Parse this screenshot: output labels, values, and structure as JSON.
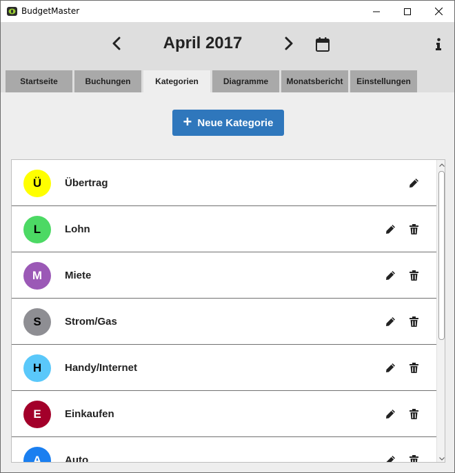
{
  "window": {
    "title": "BudgetMaster",
    "icon": "budgetmaster-logo-icon"
  },
  "header": {
    "month": "April 2017",
    "prev_icon": "chevron-left-icon",
    "next_icon": "chevron-right-icon",
    "calendar_icon": "calendar-icon",
    "info_icon": "info-icon"
  },
  "tabs": [
    {
      "label": "Startseite",
      "active": false
    },
    {
      "label": "Buchungen",
      "active": false
    },
    {
      "label": "Kategorien",
      "active": true
    },
    {
      "label": "Diagramme",
      "active": false
    },
    {
      "label": "Monatsbericht",
      "active": false
    },
    {
      "label": "Einstellungen",
      "active": false
    }
  ],
  "actions": {
    "new_category_label": "Neue Kategorie"
  },
  "categories": [
    {
      "letter": "Ü",
      "name": "Übertrag",
      "color": "#ffff00",
      "text_color": "#000000",
      "deletable": false
    },
    {
      "letter": "L",
      "name": "Lohn",
      "color": "#4cd964",
      "text_color": "#000000",
      "deletable": true
    },
    {
      "letter": "M",
      "name": "Miete",
      "color": "#9b59b6",
      "text_color": "#ffffff",
      "deletable": true
    },
    {
      "letter": "S",
      "name": "Strom/Gas",
      "color": "#8e8e93",
      "text_color": "#000000",
      "deletable": true
    },
    {
      "letter": "H",
      "name": "Handy/Internet",
      "color": "#5ac8fa",
      "text_color": "#000000",
      "deletable": true
    },
    {
      "letter": "E",
      "name": "Einkaufen",
      "color": "#a3002a",
      "text_color": "#ffffff",
      "deletable": true
    },
    {
      "letter": "A",
      "name": "Auto",
      "color": "#1a7ff0",
      "text_color": "#ffffff",
      "deletable": true
    }
  ],
  "colors": {
    "accent": "#2f77bc",
    "tab_inactive": "#a9a9a9",
    "header_bg": "#dedede"
  }
}
